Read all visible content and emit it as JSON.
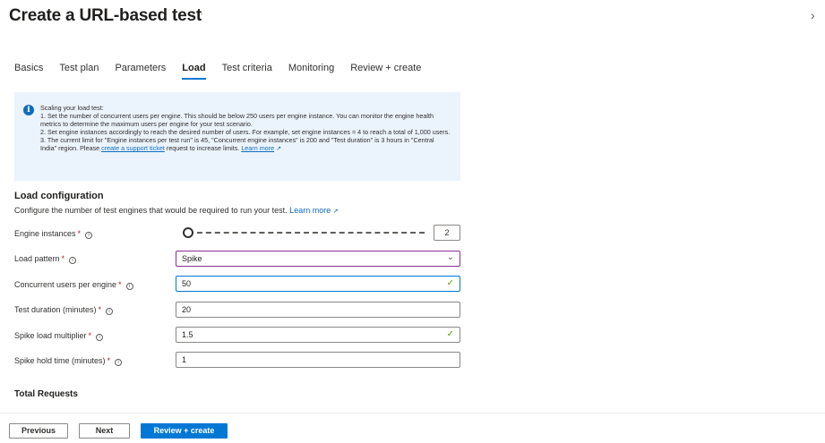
{
  "header": {
    "title": "Create a URL-based test",
    "more": "···",
    "close_glyph": "›"
  },
  "tabs": [
    {
      "label": "Basics",
      "active": false
    },
    {
      "label": "Test plan",
      "active": false
    },
    {
      "label": "Parameters",
      "active": false
    },
    {
      "label": "Load",
      "active": true
    },
    {
      "label": "Test criteria",
      "active": false
    },
    {
      "label": "Monitoring",
      "active": false
    },
    {
      "label": "Review + create",
      "active": false
    }
  ],
  "info": {
    "icon": "info-icon",
    "heading": "Scaling your load test:",
    "line1": "1. Set the number of concurrent users per engine. This should be below 250 users per engine instance. You can monitor the engine health metrics to determine the maximum users per engine for your test scenario.",
    "line2": "2. Set engine instances accordingly to reach the desired number of users. For example, set engine instances = 4 to reach a total of 1,000 users.",
    "line3_pre": "3. The current limit for \"Engine instances per test run\" is 45, \"Concurrent engine instances\" is 200 and \"Test duration\" is 3 hours in \"Central India\" region. Please",
    "support_link": "create a support ticket",
    "line3_post": "request to increase limits.",
    "learn_more": "Learn more"
  },
  "load_config": {
    "title": "Load configuration",
    "description": "Configure the number of test engines that would be required to run your test.",
    "learn_more": "Learn more"
  },
  "form": {
    "engine_instances": {
      "label": "Engine instances",
      "value": "2",
      "slider_fraction": 0.0
    },
    "load_pattern": {
      "label": "Load pattern",
      "value": "Spike"
    },
    "concurrent_users": {
      "label": "Concurrent users per engine",
      "value": "50"
    },
    "test_duration": {
      "label": "Test duration (minutes)",
      "value": "20"
    },
    "spike_multiplier": {
      "label": "Spike load multiplier",
      "value": "1.5"
    },
    "spike_hold": {
      "label": "Spike hold time (minutes)",
      "value": "1"
    }
  },
  "required_marker": "*",
  "info_circle_glyph": "i",
  "total_requests": "Total Requests",
  "footer": {
    "previous": "Previous",
    "next": "Next",
    "review_create": "Review + create"
  },
  "colors": {
    "accent": "#0078d4",
    "valid_check": "#57a300",
    "required": "#a4262c",
    "info_bg": "#ebf3fc"
  }
}
